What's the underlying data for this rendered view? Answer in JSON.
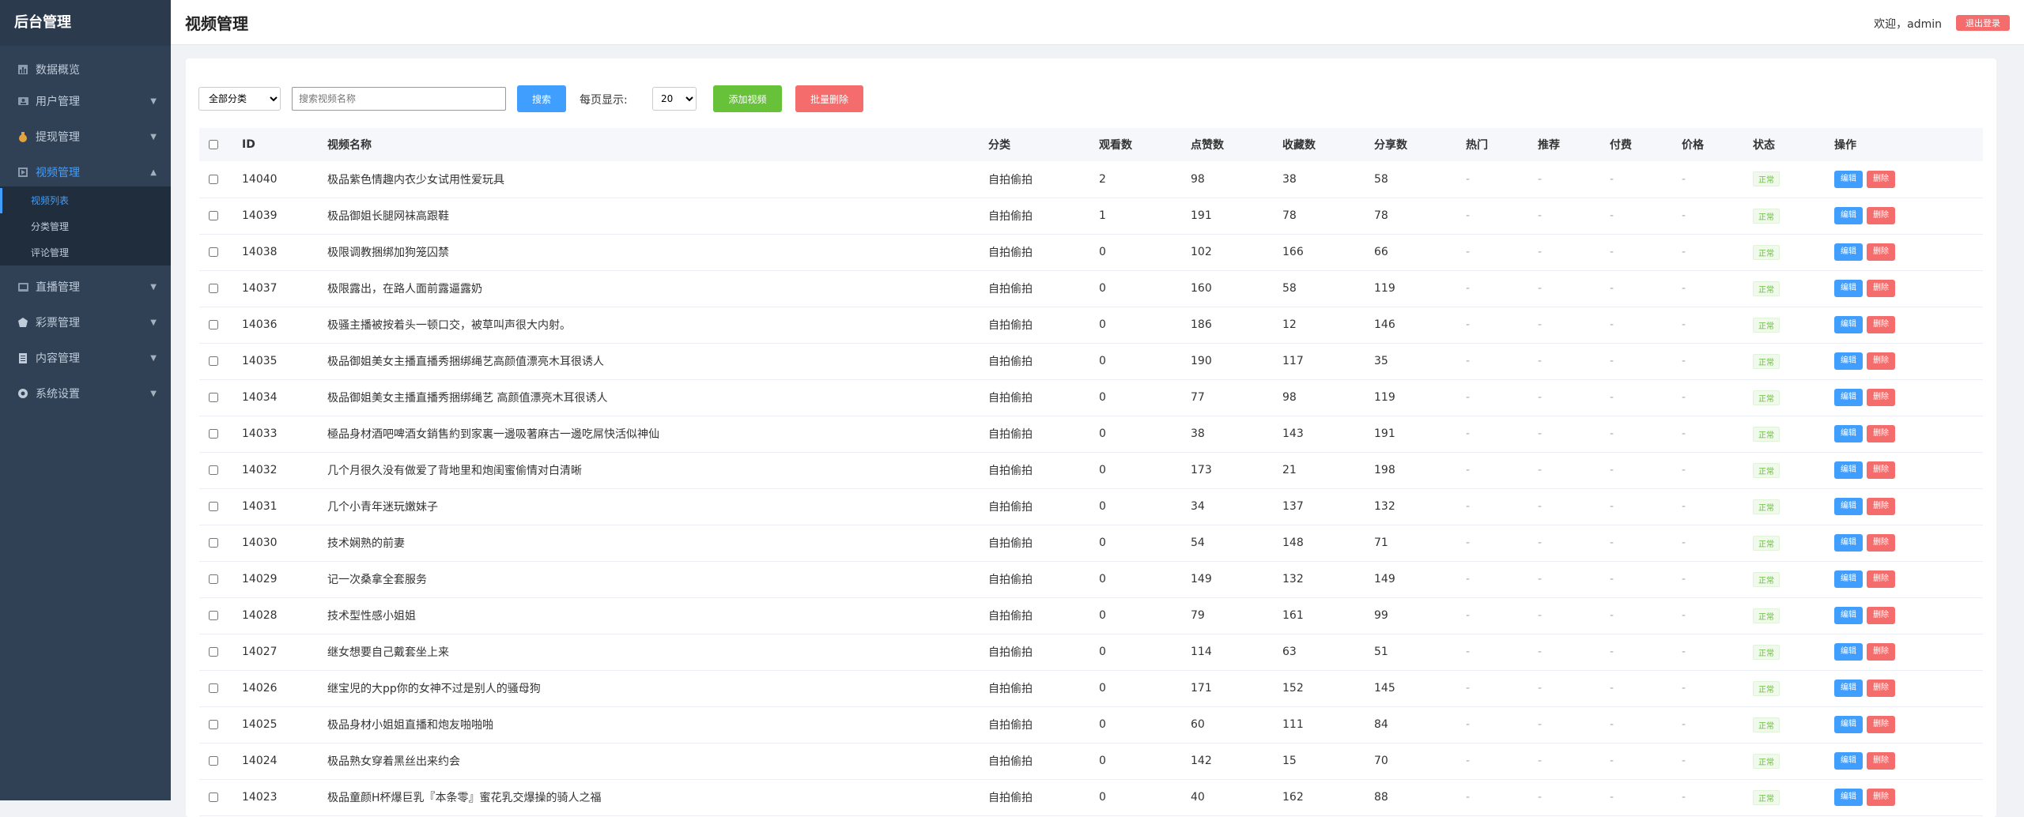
{
  "sidebar": {
    "brand": "后台管理",
    "items": [
      {
        "label": "数据概览",
        "icon": "chart-icon"
      },
      {
        "label": "用户管理",
        "icon": "user-icon"
      },
      {
        "label": "提现管理",
        "icon": "money-bag-icon"
      },
      {
        "label": "视频管理",
        "icon": "video-icon"
      },
      {
        "label": "直播管理",
        "icon": "tv-icon"
      },
      {
        "label": "彩票管理",
        "icon": "lottery-icon"
      },
      {
        "label": "内容管理",
        "icon": "document-icon"
      },
      {
        "label": "系统设置",
        "icon": "gear-icon"
      }
    ],
    "submenu": [
      "视频列表",
      "分类管理",
      "评论管理"
    ]
  },
  "header": {
    "title": "视频管理",
    "welcome": "欢迎，admin",
    "logout": "退出登录"
  },
  "toolbar": {
    "category": "全部分类",
    "search_placeholder": "搜索视频名称",
    "search_btn": "搜索",
    "perpage_label": "每页显示:",
    "perpage": "20",
    "add_btn": "添加视频",
    "batch_delete_btn": "批量删除"
  },
  "table": {
    "headers": [
      "ID",
      "视频名称",
      "分类",
      "观看数",
      "点赞数",
      "收藏数",
      "分享数",
      "热门",
      "推荐",
      "付费",
      "价格",
      "状态",
      "操作"
    ],
    "status_label": "正常",
    "edit_label": "编辑",
    "delete_label": "删除",
    "dash": "-",
    "rows": [
      {
        "id": "14040",
        "name": "极品紫色情趣内衣少女试用性爱玩具",
        "category": "自拍偷拍",
        "views": "2",
        "likes": "98",
        "favs": "38",
        "shares": "58"
      },
      {
        "id": "14039",
        "name": "极品御姐长腿网袜高跟鞋",
        "category": "自拍偷拍",
        "views": "1",
        "likes": "191",
        "favs": "78",
        "shares": "78"
      },
      {
        "id": "14038",
        "name": "极限调教捆绑加狗笼囚禁",
        "category": "自拍偷拍",
        "views": "0",
        "likes": "102",
        "favs": "166",
        "shares": "66"
      },
      {
        "id": "14037",
        "name": "极限露出，在路人面前露逼露奶",
        "category": "自拍偷拍",
        "views": "0",
        "likes": "160",
        "favs": "58",
        "shares": "119"
      },
      {
        "id": "14036",
        "name": "极骚主播被按着头一顿口交，被草叫声很大内射。",
        "category": "自拍偷拍",
        "views": "0",
        "likes": "186",
        "favs": "12",
        "shares": "146"
      },
      {
        "id": "14035",
        "name": "极品御姐美女主播直播秀捆绑绳艺高颜值漂亮木耳很诱人",
        "category": "自拍偷拍",
        "views": "0",
        "likes": "190",
        "favs": "117",
        "shares": "35"
      },
      {
        "id": "14034",
        "name": "极品御姐美女主播直播秀捆绑绳艺 高颜值漂亮木耳很诱人",
        "category": "自拍偷拍",
        "views": "0",
        "likes": "77",
        "favs": "98",
        "shares": "119"
      },
      {
        "id": "14033",
        "name": "極品身材酒吧啤酒女銷售約到家裏一邊吸著麻古一邊吃屌快活似神仙",
        "category": "自拍偷拍",
        "views": "0",
        "likes": "38",
        "favs": "143",
        "shares": "191"
      },
      {
        "id": "14032",
        "name": "几个月很久没有做爱了背地里和炮闺蜜偷情对白清晰",
        "category": "自拍偷拍",
        "views": "0",
        "likes": "173",
        "favs": "21",
        "shares": "198"
      },
      {
        "id": "14031",
        "name": "几个小青年迷玩嫩妹子",
        "category": "自拍偷拍",
        "views": "0",
        "likes": "34",
        "favs": "137",
        "shares": "132"
      },
      {
        "id": "14030",
        "name": "技术娴熟的前妻",
        "category": "自拍偷拍",
        "views": "0",
        "likes": "54",
        "favs": "148",
        "shares": "71"
      },
      {
        "id": "14029",
        "name": "记一次桑拿全套服务",
        "category": "自拍偷拍",
        "views": "0",
        "likes": "149",
        "favs": "132",
        "shares": "149"
      },
      {
        "id": "14028",
        "name": "技术型性感小姐姐",
        "category": "自拍偷拍",
        "views": "0",
        "likes": "79",
        "favs": "161",
        "shares": "99"
      },
      {
        "id": "14027",
        "name": "继女想要自己戴套坐上来",
        "category": "自拍偷拍",
        "views": "0",
        "likes": "114",
        "favs": "63",
        "shares": "51"
      },
      {
        "id": "14026",
        "name": "继宝児的大pp你的女神不过是别人的骚母狗",
        "category": "自拍偷拍",
        "views": "0",
        "likes": "171",
        "favs": "152",
        "shares": "145"
      },
      {
        "id": "14025",
        "name": "极品身材小姐姐直播和炮友啪啪啪",
        "category": "自拍偷拍",
        "views": "0",
        "likes": "60",
        "favs": "111",
        "shares": "84"
      },
      {
        "id": "14024",
        "name": "极品熟女穿着黑丝出来约会",
        "category": "自拍偷拍",
        "views": "0",
        "likes": "142",
        "favs": "15",
        "shares": "70"
      },
      {
        "id": "14023",
        "name": "极品童颜H杯爆巨乳『本条零』蜜花乳交爆操的骑人之福",
        "category": "自拍偷拍",
        "views": "0",
        "likes": "40",
        "favs": "162",
        "shares": "88"
      }
    ]
  },
  "colors": {
    "accent": "#409eff",
    "sidebar_bg": "#304156",
    "success": "#67c23a",
    "danger": "#f56c6c"
  }
}
